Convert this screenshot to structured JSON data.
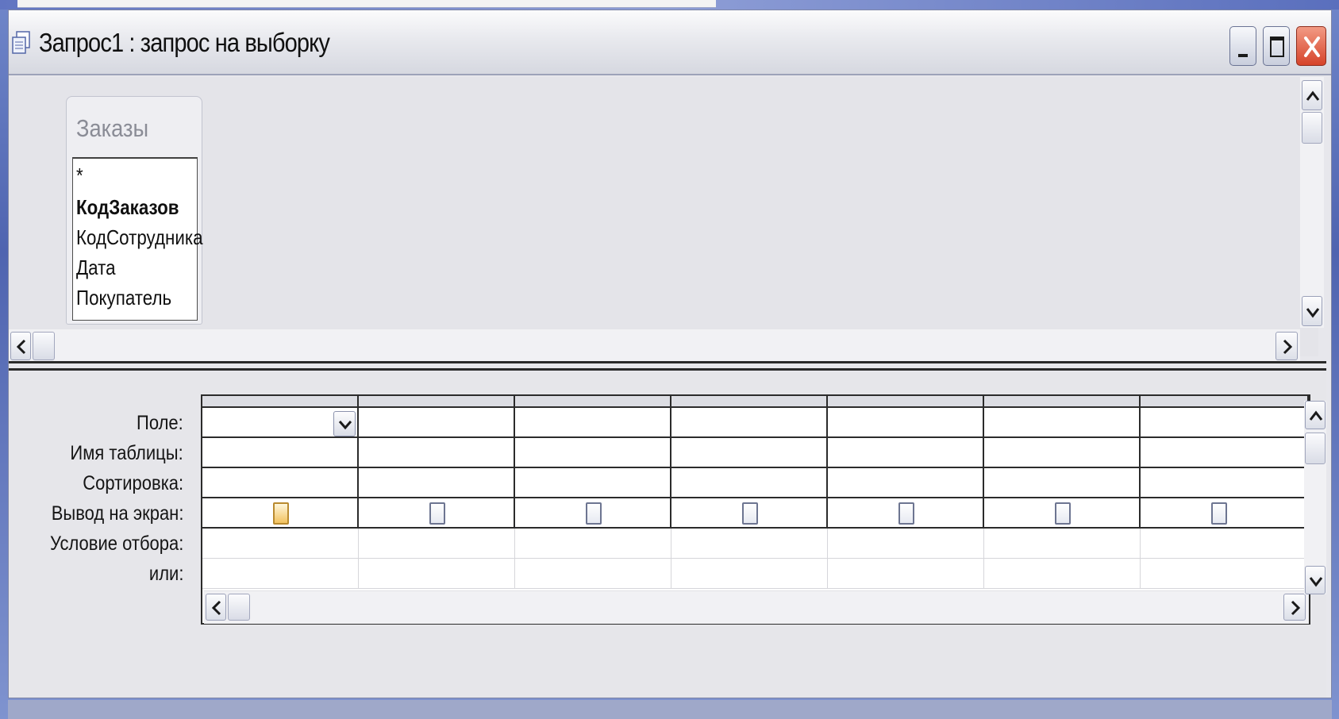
{
  "window": {
    "title": "Запрос1 : запрос на выборку",
    "controls": [
      "minimize-icon",
      "maximize-icon",
      "close-icon"
    ]
  },
  "table": {
    "name": "Заказы",
    "fields": [
      {
        "label": "*",
        "bold": false
      },
      {
        "label": "КодЗаказов",
        "bold": true
      },
      {
        "label": "КодСотрудника",
        "bold": false
      },
      {
        "label": "Дата",
        "bold": false
      },
      {
        "label": "Покупатель",
        "bold": false
      }
    ]
  },
  "grid": {
    "row_labels": {
      "field": "Поле:",
      "table": "Имя таблицы:",
      "sort": "Сортировка:",
      "show": "Вывод на экран:",
      "criteria": "Условие отбора:",
      "or": "или:"
    },
    "columns": [
      {
        "field": "",
        "table": "",
        "sort": "",
        "show": false,
        "criteria": "",
        "or": "",
        "focused": true
      },
      {
        "field": "",
        "table": "",
        "sort": "",
        "show": false,
        "criteria": "",
        "or": ""
      },
      {
        "field": "",
        "table": "",
        "sort": "",
        "show": false,
        "criteria": "",
        "or": ""
      },
      {
        "field": "",
        "table": "",
        "sort": "",
        "show": false,
        "criteria": "",
        "or": ""
      },
      {
        "field": "",
        "table": "",
        "sort": "",
        "show": false,
        "criteria": "",
        "or": ""
      },
      {
        "field": "",
        "table": "",
        "sort": "",
        "show": false,
        "criteria": "",
        "or": ""
      },
      {
        "field": "",
        "table": "",
        "sort": "",
        "show": false,
        "criteria": "",
        "or": ""
      }
    ]
  },
  "colors": {
    "window_bg": "#e7e7ec",
    "grid_line": "#2b2b2b",
    "close_button": "#d6432a"
  }
}
